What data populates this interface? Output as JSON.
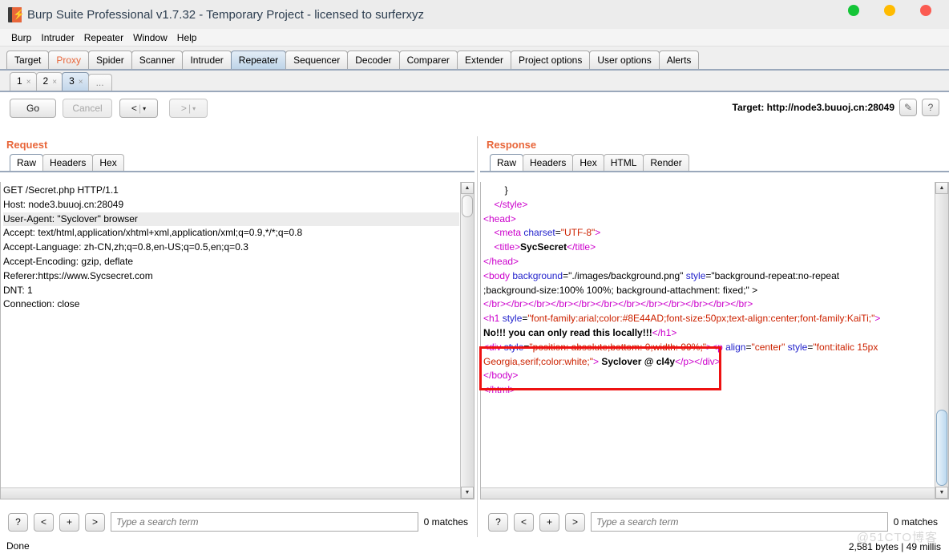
{
  "window": {
    "title": "Burp Suite Professional v1.7.32 - Temporary Project - licensed to surferxyz",
    "controls": {
      "minimize": "minimize",
      "maximize": "maximize",
      "close": "close"
    },
    "colors": {
      "minimize": "#14c537",
      "maximize": "#ffbb00",
      "close": "#fb5b51"
    }
  },
  "menubar": {
    "items": [
      "Burp",
      "Intruder",
      "Repeater",
      "Window",
      "Help"
    ]
  },
  "main_tabs": {
    "selected": "Repeater",
    "items": [
      {
        "label": "Target",
        "accent": false
      },
      {
        "label": "Proxy",
        "accent": true
      },
      {
        "label": "Spider",
        "accent": false
      },
      {
        "label": "Scanner",
        "accent": false
      },
      {
        "label": "Intruder",
        "accent": false
      },
      {
        "label": "Repeater",
        "accent": false
      },
      {
        "label": "Sequencer",
        "accent": false
      },
      {
        "label": "Decoder",
        "accent": false
      },
      {
        "label": "Comparer",
        "accent": false
      },
      {
        "label": "Extender",
        "accent": false
      },
      {
        "label": "Project options",
        "accent": false
      },
      {
        "label": "User options",
        "accent": false
      },
      {
        "label": "Alerts",
        "accent": false
      }
    ]
  },
  "repeater_tabs": {
    "selected": "3",
    "items": [
      {
        "label": "1",
        "close": "×"
      },
      {
        "label": "2",
        "close": "×"
      },
      {
        "label": "3",
        "close": "×"
      }
    ],
    "more_label": "..."
  },
  "toolbar": {
    "go_label": "Go",
    "cancel_label": "Cancel",
    "prev_label": "<",
    "next_label": ">",
    "separator": "|",
    "caret": "▾",
    "target_label": "Target: http://node3.buuoj.cn:28049",
    "edit_icon": "✎",
    "help_icon": "?"
  },
  "request_panel": {
    "title": "Request",
    "tabs": [
      "Raw",
      "Headers",
      "Hex"
    ],
    "selected_tab": "Raw",
    "lines": [
      {
        "text": "GET /Secret.php HTTP/1.1",
        "highlight": false
      },
      {
        "text": "Host: node3.buuoj.cn:28049",
        "highlight": false
      },
      {
        "text": "User-Agent: \"Syclover\" browser",
        "highlight": true
      },
      {
        "text": "Accept: text/html,application/xhtml+xml,application/xml;q=0.9,*/*;q=0.8",
        "highlight": false
      },
      {
        "text": "Accept-Language: zh-CN,zh;q=0.8,en-US;q=0.5,en;q=0.3",
        "highlight": false
      },
      {
        "text": "Accept-Encoding: gzip, deflate",
        "highlight": false
      },
      {
        "text": "Referer:https://www.Sycsecret.com",
        "highlight": false
      },
      {
        "text": "DNT: 1",
        "highlight": false
      },
      {
        "text": "Connection: close",
        "highlight": false
      }
    ],
    "search": {
      "help_label": "?",
      "prev_label": "<",
      "add_label": "+",
      "next_label": ">",
      "placeholder": "Type a search term",
      "value": "",
      "matches": "0 matches"
    }
  },
  "response_panel": {
    "title": "Response",
    "tabs": [
      "Raw",
      "Headers",
      "Hex",
      "HTML",
      "Render"
    ],
    "selected_tab": "Raw",
    "lines": [
      [
        {
          "t": "plain",
          "s": "        }"
        }
      ],
      [
        {
          "t": "plain",
          "s": "    "
        },
        {
          "t": "tag",
          "s": "</style>"
        }
      ],
      [
        {
          "t": "plain",
          "s": ""
        }
      ],
      [
        {
          "t": "plain",
          "s": ""
        }
      ],
      [
        {
          "t": "tag",
          "s": "<head>"
        }
      ],
      [
        {
          "t": "plain",
          "s": "    "
        },
        {
          "t": "tag",
          "s": "<meta "
        },
        {
          "t": "attr",
          "s": "charset"
        },
        {
          "t": "plain",
          "s": "="
        },
        {
          "t": "val",
          "s": "\"UTF-8\""
        },
        {
          "t": "tag",
          "s": ">"
        }
      ],
      [
        {
          "t": "plain",
          "s": "    "
        },
        {
          "t": "tag",
          "s": "<title>"
        },
        {
          "t": "txt",
          "s": "SycSecret"
        },
        {
          "t": "tag",
          "s": "</title>"
        }
      ],
      [
        {
          "t": "tag",
          "s": "</head>"
        }
      ],
      [
        {
          "t": "tag",
          "s": "<body "
        },
        {
          "t": "attr",
          "s": "background"
        },
        {
          "t": "plain",
          "s": "=\"./images/background.png\" "
        },
        {
          "t": "attr",
          "s": "style"
        },
        {
          "t": "plain",
          "s": "=\"background-repeat:no-repeat"
        }
      ],
      [
        {
          "t": "plain",
          "s": ";background-size:100% 100%; background-attachment: fixed;\" >"
        }
      ],
      [
        {
          "t": "plain",
          "s": ""
        }
      ],
      [
        {
          "t": "tag",
          "s": "</br></br></br></br></br></br></br></br></br></br></br></br>"
        }
      ],
      [
        {
          "t": "tag",
          "s": "<h1 "
        },
        {
          "t": "attr",
          "s": "style"
        },
        {
          "t": "plain",
          "s": "="
        },
        {
          "t": "val",
          "s": "\"font-family:arial;color:#8E44AD;font-size:50px;text-align:center;font-family:KaiTi;\""
        },
        {
          "t": "tag",
          "s": ">"
        }
      ],
      [
        {
          "t": "txt",
          "s": "No!!! you can only read this locally!!!"
        },
        {
          "t": "tag",
          "s": "</h1>"
        }
      ],
      [
        {
          "t": "tag",
          "s": "<div "
        },
        {
          "t": "attr",
          "s": "style"
        },
        {
          "t": "plain",
          "s": "="
        },
        {
          "t": "val",
          "s": "\"position: absolute;bottom: 0;width: 99%;\""
        },
        {
          "t": "tag",
          "s": ">"
        },
        {
          "t": "tag",
          "s": "<p "
        },
        {
          "t": "attr",
          "s": "align"
        },
        {
          "t": "plain",
          "s": "="
        },
        {
          "t": "val",
          "s": "\"center\""
        },
        {
          "t": "plain",
          "s": " "
        },
        {
          "t": "attr",
          "s": "style"
        },
        {
          "t": "plain",
          "s": "="
        },
        {
          "t": "val",
          "s": "\"font:italic 15px"
        }
      ],
      [
        {
          "t": "val",
          "s": "Georgia,serif;color:white;\""
        },
        {
          "t": "tag",
          "s": ">"
        },
        {
          "t": "txt",
          "s": " Syclover @ cl4y"
        },
        {
          "t": "tag",
          "s": "</p></div>"
        }
      ],
      [
        {
          "t": "tag",
          "s": "</body>"
        }
      ],
      [
        {
          "t": "tag",
          "s": "</html>"
        }
      ]
    ],
    "search": {
      "help_label": "?",
      "prev_label": "<",
      "add_label": "+",
      "next_label": ">",
      "placeholder": "Type a search term",
      "value": "",
      "matches": "0 matches"
    }
  },
  "annotation": {
    "color": "#ee1111",
    "label": "highlighted-response-region"
  },
  "statusbar": {
    "left": "Done",
    "right": "2,581 bytes | 49 millis",
    "watermark": "@51CTO博客"
  }
}
